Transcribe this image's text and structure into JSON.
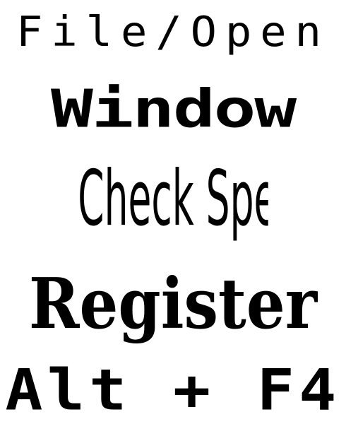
{
  "specimens": [
    {
      "text": "File/Open"
    },
    {
      "text": "Window"
    },
    {
      "text": "Check Spelling..."
    },
    {
      "text": "Register"
    },
    {
      "text": "Alt + F4"
    }
  ],
  "colors": {
    "background": "#ffffff",
    "text": "#000000"
  }
}
